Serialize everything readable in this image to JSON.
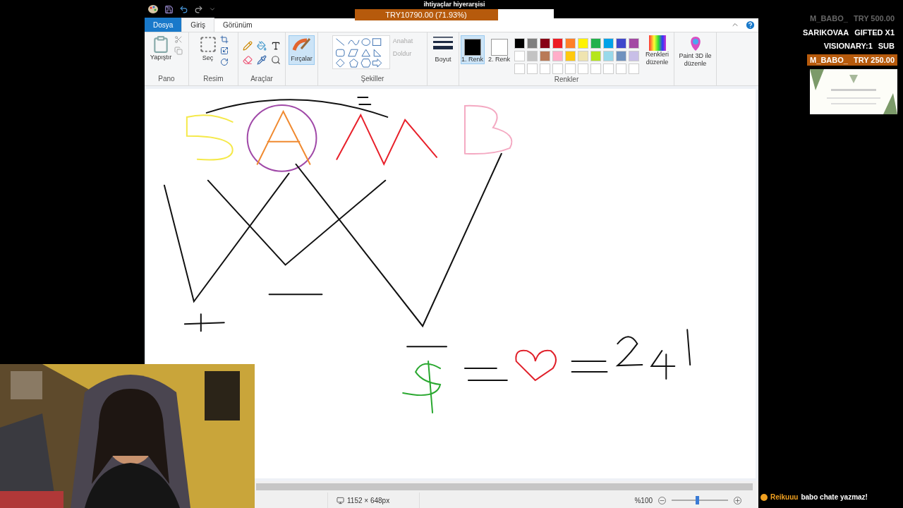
{
  "goal": {
    "title": "ihtiyaçlar hiyerarşisi",
    "amount": "TRY10790.00 (71.93%)",
    "level": 0.7193
  },
  "ribbon": {
    "tabs": [
      {
        "label": "Dosya",
        "kind": "file",
        "selected": false
      },
      {
        "label": "Giriş",
        "kind": "tab",
        "selected": true
      },
      {
        "label": "Görünüm",
        "kind": "tab",
        "selected": false
      }
    ],
    "clipboard": {
      "label": "Pano",
      "paste": "Yapıştır"
    },
    "image": {
      "label": "Resim",
      "select": "Seç"
    },
    "tools": {
      "label": "Araçlar"
    },
    "brushes": {
      "label": "Fırçalar"
    },
    "shapes": {
      "label": "Şekiller",
      "outline": "Anahat",
      "fill": "Doldur"
    },
    "size": {
      "label": "Boyut"
    },
    "colors": {
      "label": "Renkler",
      "slots": [
        {
          "label": "1. Renk",
          "selected": true,
          "color": "#000000"
        },
        {
          "label": "2. Renk",
          "selected": false,
          "color": "#ffffff"
        }
      ],
      "swatches": [
        {
          "color": "#000000"
        },
        {
          "color": "#7f7f7f"
        },
        {
          "color": "#880015"
        },
        {
          "color": "#ed1c24"
        },
        {
          "color": "#ff7f27"
        },
        {
          "color": "#fff200"
        },
        {
          "color": "#22b14c"
        },
        {
          "color": "#00a2e8"
        },
        {
          "color": "#3f48cc"
        },
        {
          "color": "#a349a4"
        },
        {
          "color": "#ffffff"
        },
        {
          "color": "#c3c3c3"
        },
        {
          "color": "#b97a57"
        },
        {
          "color": "#ffaec9"
        },
        {
          "color": "#ffc90e"
        },
        {
          "color": "#efe4b0"
        },
        {
          "color": "#b5e61d"
        },
        {
          "color": "#99d9ea"
        },
        {
          "color": "#7092be"
        },
        {
          "color": "#c8bfe7"
        }
      ],
      "edit": "Renkleri düzenle"
    },
    "paint3d": "Paint 3D ile düzenle"
  },
  "status_bar": {
    "size": "1152 × 648px",
    "zoom": "%100",
    "zoom_slider": {
      "level": 0.45
    }
  },
  "alerts": [
    {
      "name": "M_BABO_",
      "detail": "TRY 500.00",
      "highlighted": false
    },
    {
      "name": "SARIKOVAA",
      "detail": "GIFTED X1",
      "highlighted": false
    },
    {
      "name": "VISIONARY:1",
      "detail": "SUB",
      "highlighted": false
    },
    {
      "name": "M_BABO_",
      "detail": "TRY 250.00",
      "highlighted": true
    }
  ],
  "chat": {
    "user": "Reikuuu",
    "message": "babo chate yazmaz!"
  }
}
